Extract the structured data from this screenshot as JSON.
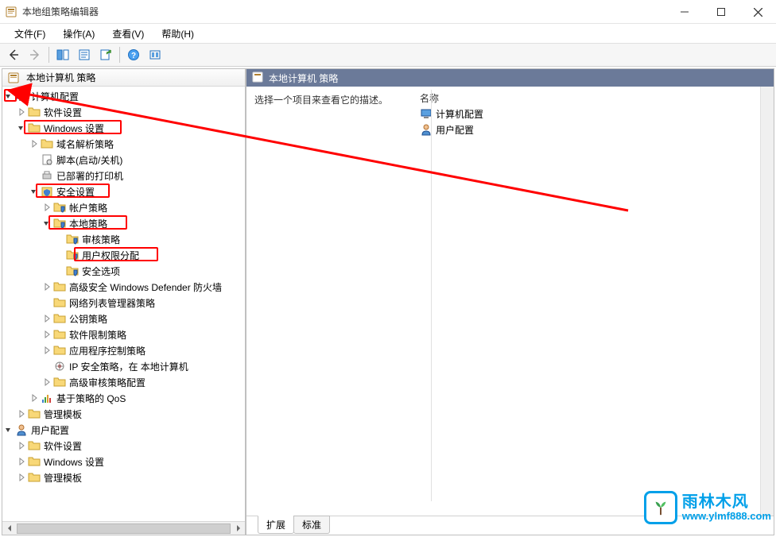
{
  "window": {
    "title": "本地组策略编辑器"
  },
  "menu": {
    "file": "文件(F)",
    "action": "操作(A)",
    "view": "查看(V)",
    "help": "帮助(H)"
  },
  "tree": {
    "root": "本地计算机 策略",
    "computer_config": "计算机配置",
    "software_settings": "软件设置",
    "windows_settings": "Windows 设置",
    "dns_policy": "域名解析策略",
    "scripts": "脚本(启动/关机)",
    "deployed_printers": "已部署的打印机",
    "security_settings": "安全设置",
    "account_policy": "帐户策略",
    "local_policy": "本地策略",
    "audit_policy": "审核策略",
    "user_rights": "用户权限分配",
    "security_options": "安全选项",
    "defender_firewall": "高级安全 Windows Defender 防火墙",
    "network_list_mgr": "网络列表管理器策略",
    "public_key_policy": "公钥策略",
    "software_restrict": "软件限制策略",
    "app_control": "应用程序控制策略",
    "ip_security": "IP 安全策略，在 本地计算机",
    "adv_audit_config": "高级审核策略配置",
    "policy_qos": "基于策略的 QoS",
    "admin_templates": "管理模板",
    "user_config": "用户配置",
    "software_settings_u": "软件设置",
    "windows_settings_u": "Windows 设置",
    "admin_templates_u": "管理模板"
  },
  "right": {
    "header": "本地计算机 策略",
    "description": "选择一个项目来查看它的描述。",
    "column_name": "名称",
    "item_computer": "计算机配置",
    "item_user": "用户配置",
    "tab_extended": "扩展",
    "tab_standard": "标准"
  },
  "watermark": {
    "cn": "雨林木风",
    "url": "www.ylmf888.com"
  }
}
